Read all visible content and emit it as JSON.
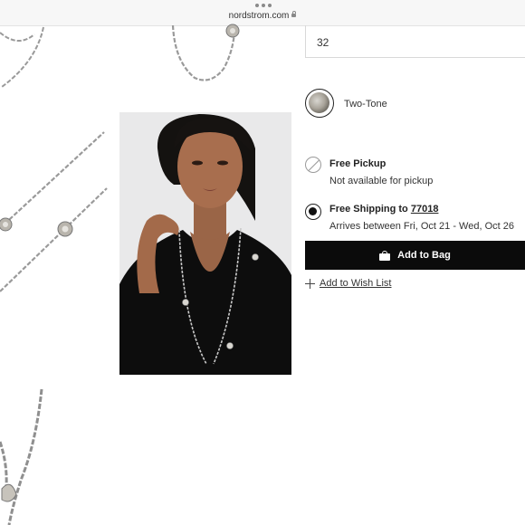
{
  "browser": {
    "url": "nordstrom.com",
    "menu_icon": "more-dots-icon",
    "secure_icon": "lock-icon"
  },
  "product": {
    "size_value": "32",
    "color_label": "Two-Tone",
    "pickup": {
      "title": "Free Pickup",
      "status": "Not available for pickup"
    },
    "shipping": {
      "title_prefix": "Free Shipping to ",
      "zip": "77018",
      "arrival": "Arrives between Fri, Oct 21 - Wed, Oct 26"
    },
    "add_to_bag_label": "Add to Bag",
    "wishlist_label": "Add to Wish List"
  },
  "colors": {
    "button_bg": "#0b0b0b",
    "text": "#222222",
    "photo_bg": "#e9e9ea",
    "chain_metal": "#9a9a9a"
  }
}
